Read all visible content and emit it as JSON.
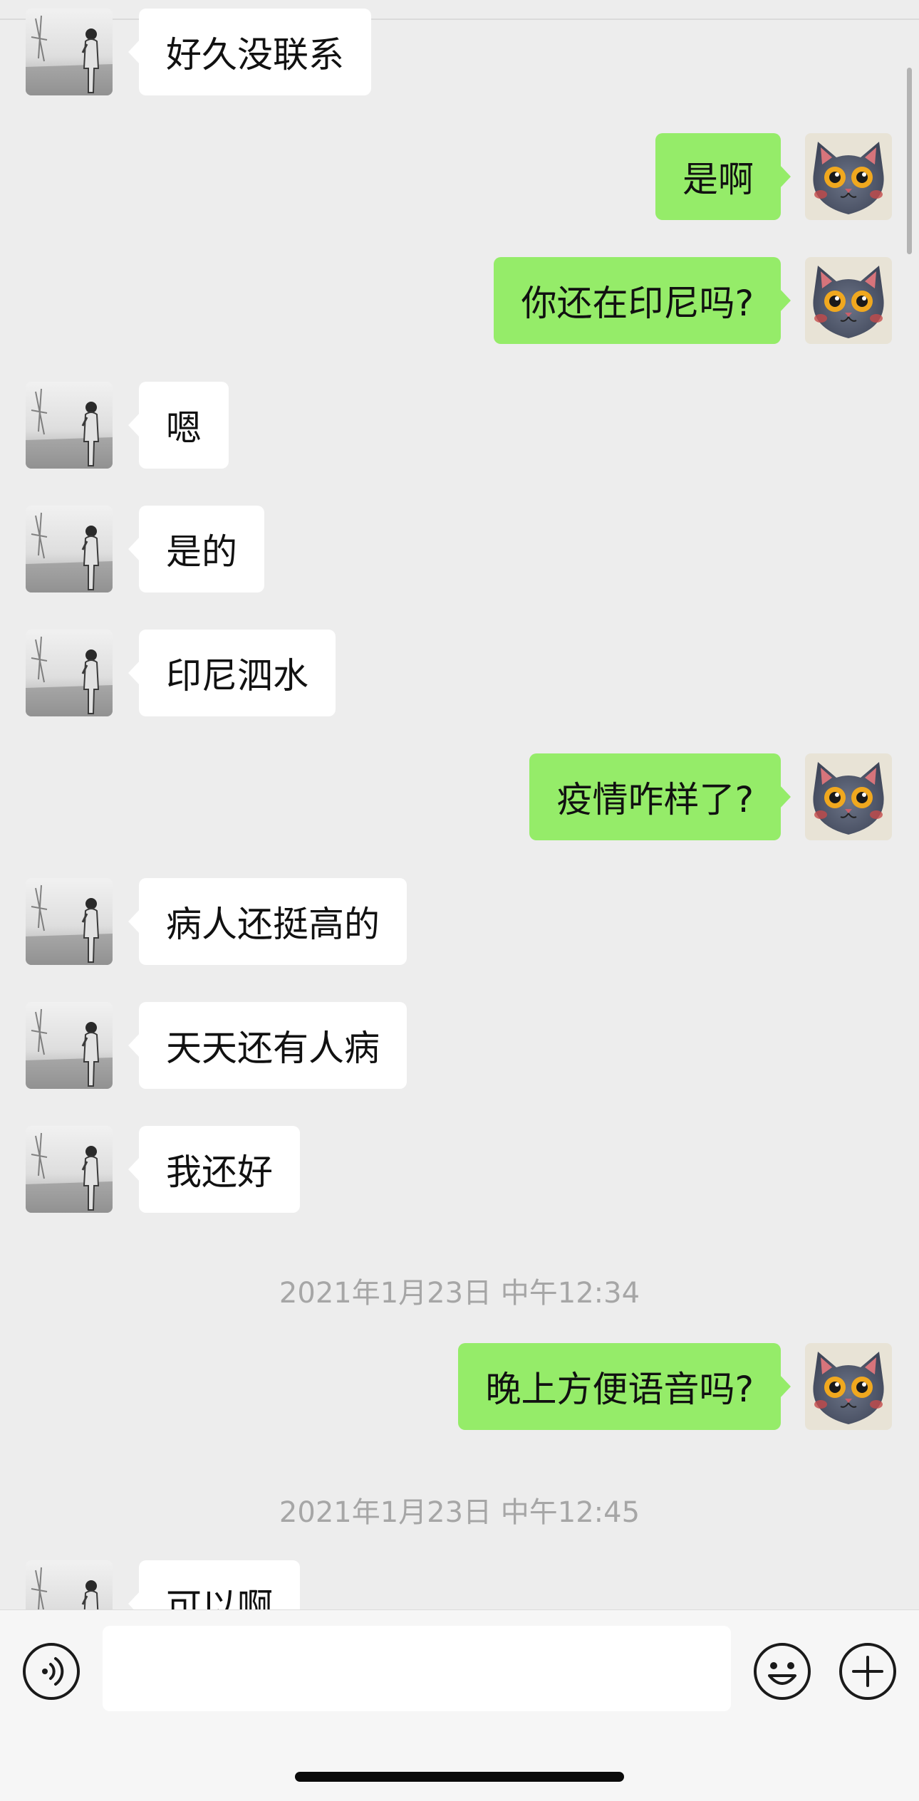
{
  "conversation": {
    "messages": [
      {
        "side": "left",
        "text": "好久没联系"
      },
      {
        "side": "right",
        "text": "是啊"
      },
      {
        "side": "right",
        "text": "你还在印尼吗?"
      },
      {
        "side": "left",
        "text": "嗯"
      },
      {
        "side": "left",
        "text": "是的"
      },
      {
        "side": "left",
        "text": "印尼泗水"
      },
      {
        "side": "right",
        "text": "疫情咋样了?"
      },
      {
        "side": "left",
        "text": "病人还挺高的"
      },
      {
        "side": "left",
        "text": "天天还有人病"
      },
      {
        "side": "left",
        "text": "我还好"
      },
      {
        "timestamp": "2021年1月23日 中午12:34"
      },
      {
        "side": "right",
        "text": "晚上方便语音吗?"
      },
      {
        "timestamp": "2021年1月23日 中午12:45"
      },
      {
        "side": "left",
        "text": "可以啊"
      }
    ]
  },
  "input_bar": {
    "message_value": "",
    "icons": {
      "voice": "voice-icon",
      "emoji": "emoji-icon",
      "more": "plus-icon"
    }
  },
  "colors": {
    "background": "#ededed",
    "own_bubble": "#95ec69",
    "other_bubble": "#ffffff",
    "timestamp_text": "#a6a6a6"
  },
  "avatars": {
    "other": "grayscale-person-photo",
    "self": "gray-cat-illustration"
  }
}
